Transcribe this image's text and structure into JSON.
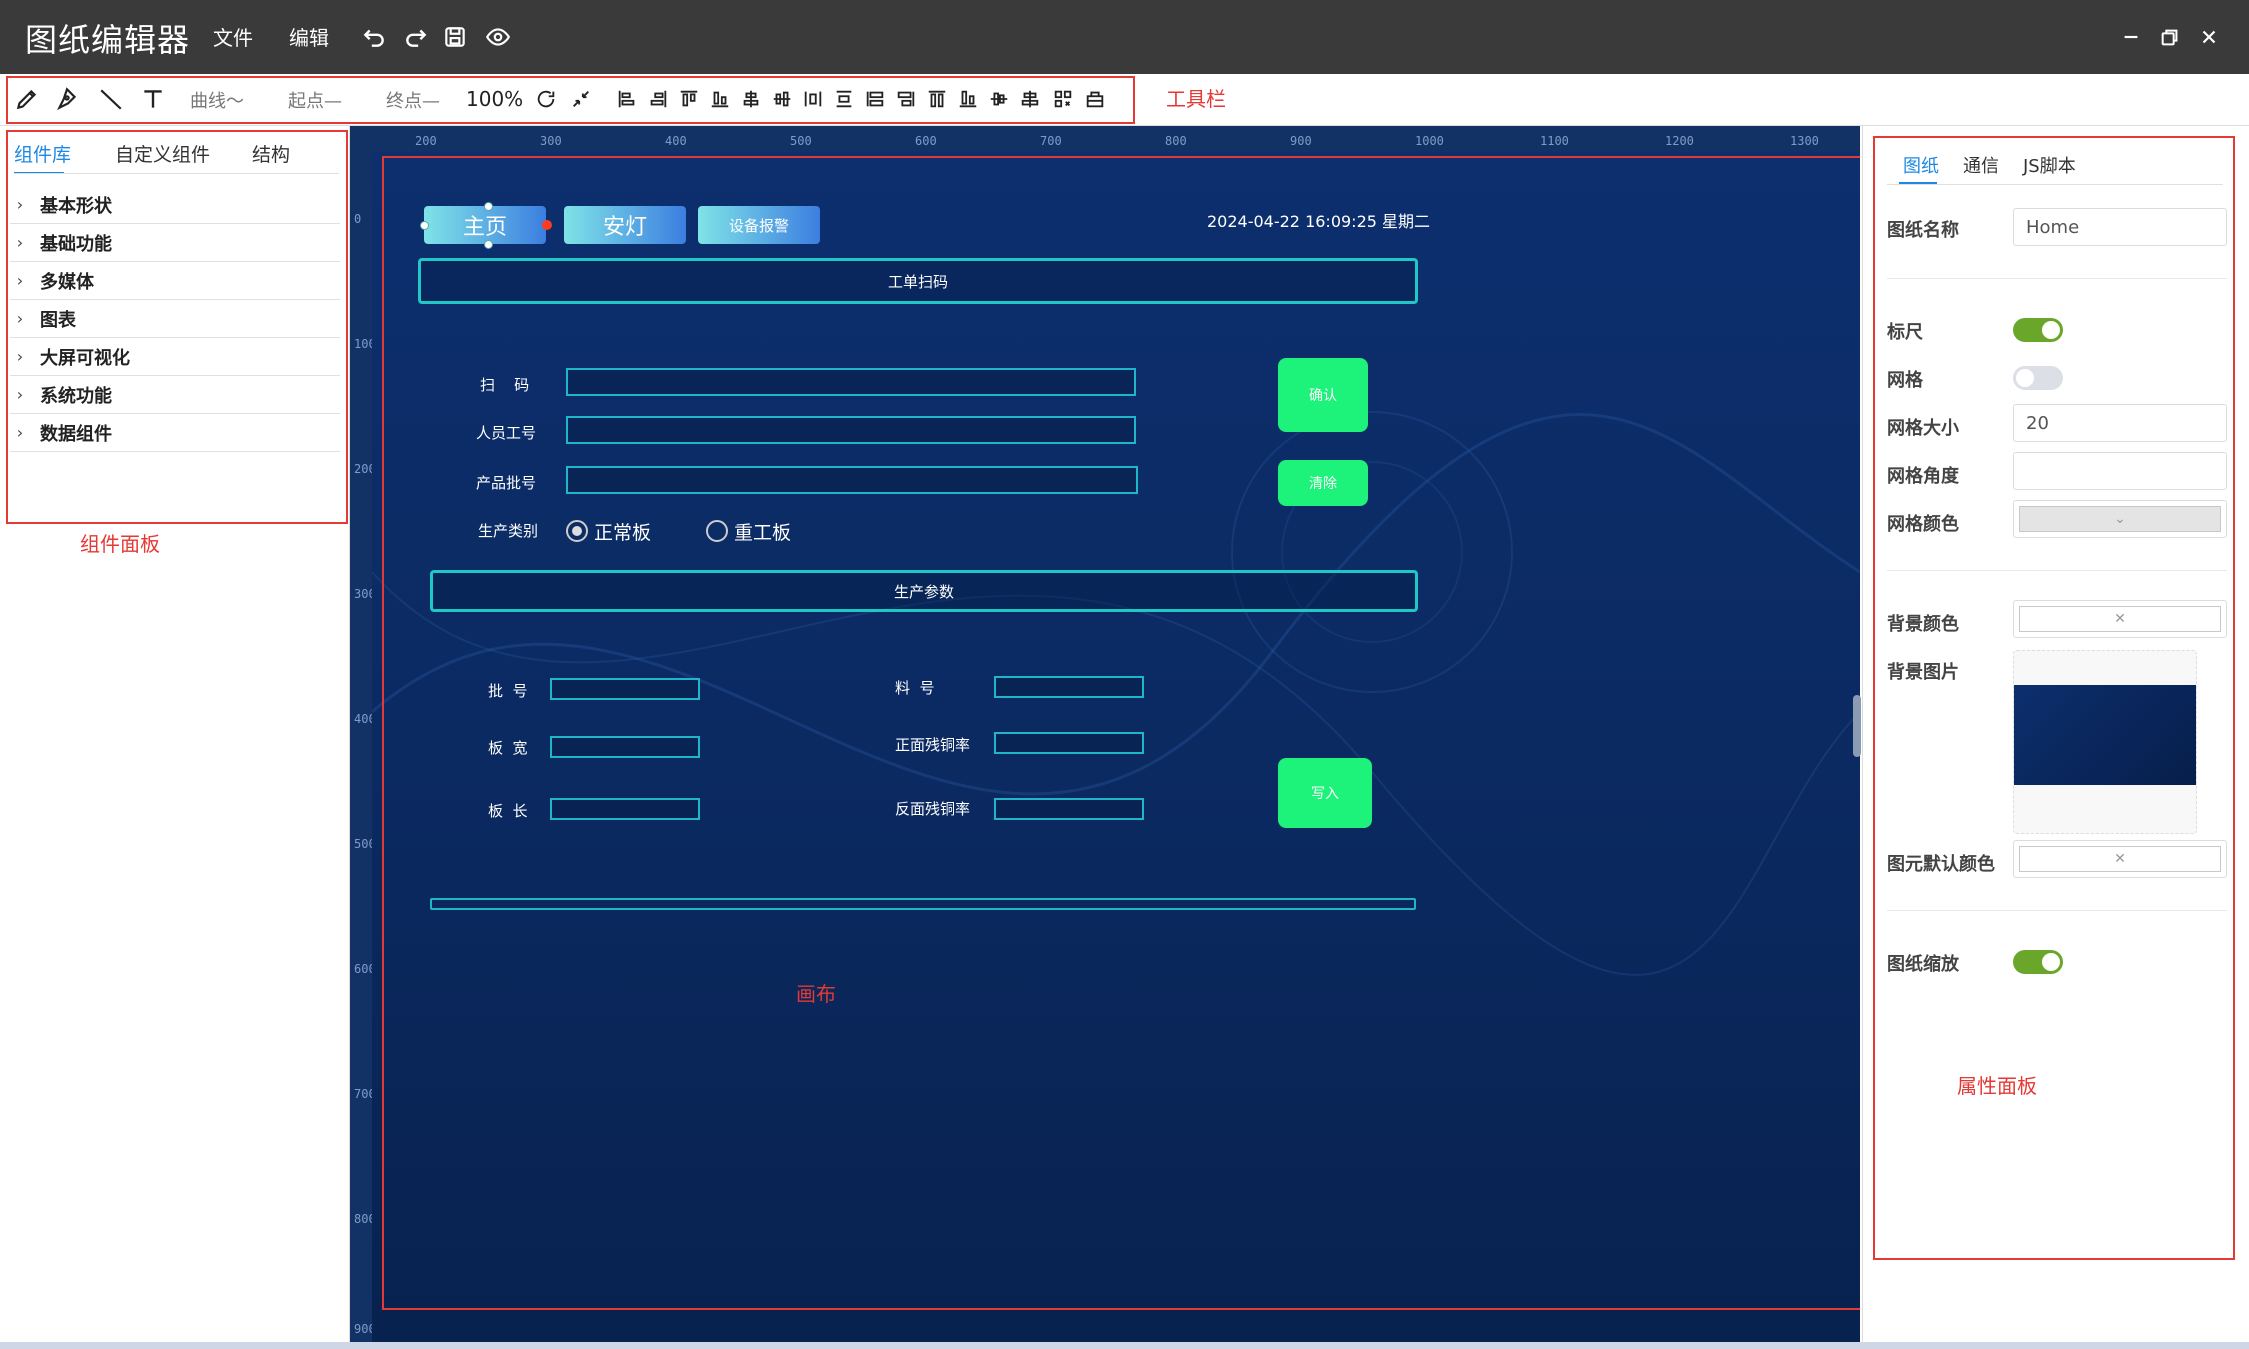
{
  "titlebar": {
    "app_title": "图纸编辑器",
    "menu": [
      "文件",
      "编辑"
    ],
    "icons": [
      "undo-icon",
      "redo-icon",
      "save-icon",
      "preview-eye-icon"
    ],
    "window_controls": [
      "minimize-icon",
      "restore-icon",
      "close-icon"
    ]
  },
  "toolbar": {
    "tools": [
      "pencil-icon",
      "pen-icon",
      "line-icon",
      "text-icon"
    ],
    "curve_label": "曲线～",
    "start_label": "起点—",
    "end_label": "终点—",
    "zoom": "100%",
    "align_icons": [
      "rotate-icon",
      "shrink-icon",
      "align-left-icon",
      "align-right-icon",
      "align-top-icon",
      "align-bottom-icon",
      "align-hcenter-icon",
      "align-vcenter-icon",
      "distribute-h-icon",
      "distribute-v-icon",
      "same-width-icon",
      "same-height-icon",
      "top-layer-icon",
      "bottom-layer-icon",
      "center-h-icon",
      "center-v-icon",
      "group-icon",
      "ungroup-icon"
    ],
    "annotation": "工具栏"
  },
  "left_panel": {
    "tabs": [
      "组件库",
      "自定义组件",
      "结构"
    ],
    "active_tab": "组件库",
    "categories": [
      "基本形状",
      "基础功能",
      "多媒体",
      "图表",
      "大屏可视化",
      "系统功能",
      "数据组件"
    ],
    "annotation": "组件面板"
  },
  "canvas": {
    "ruler_top": [
      "200",
      "300",
      "400",
      "500",
      "600",
      "700",
      "800",
      "900",
      "1000",
      "1100",
      "1200",
      "1300"
    ],
    "ruler_left": [
      "0",
      "100",
      "200",
      "300",
      "400",
      "500",
      "600",
      "700",
      "800",
      "900"
    ],
    "nav_buttons": [
      "主页",
      "安灯",
      "设备报警"
    ],
    "datetime": "2024-04-22 16:09:25 星期二",
    "section1_title": "工单扫码",
    "scan_label": "扫    码",
    "worker_label": "人员工号",
    "batch_label": "产品批号",
    "type_label": "生产类别",
    "radio_normal": "正常板",
    "radio_rework": "重工板",
    "confirm_button": "确认",
    "clear_button": "清除",
    "section2_title": "生产参数",
    "param_batch": "批  号",
    "param_material": "料  号",
    "param_width": "板  宽",
    "param_front": "正面残铜率",
    "param_length": "板  长",
    "param_back": "反面残铜率",
    "write_button": "写入",
    "annotation": "画布"
  },
  "right_panel": {
    "tabs": [
      "图纸",
      "通信",
      "JS脚本"
    ],
    "active_tab": "图纸",
    "name_label": "图纸名称",
    "name_value": "Home",
    "ruler_label": "标尺",
    "ruler_on": true,
    "grid_label": "网格",
    "grid_on": false,
    "grid_size_label": "网格大小",
    "grid_size_value": "20",
    "grid_angle_label": "网格角度",
    "grid_angle_value": "",
    "grid_color_label": "网格颜色",
    "bg_color_label": "背景颜色",
    "bg_image_label": "背景图片",
    "default_color_label": "图元默认颜色",
    "zoom_label": "图纸缩放",
    "zoom_on": true,
    "annotation": "属性面板"
  },
  "colors": {
    "annotation_red": "#e53935",
    "accent_blue": "#1e88e5",
    "toggle_green": "#6aa62a",
    "button_green": "#1df27a",
    "frame_cyan": "#1fc7c7"
  }
}
